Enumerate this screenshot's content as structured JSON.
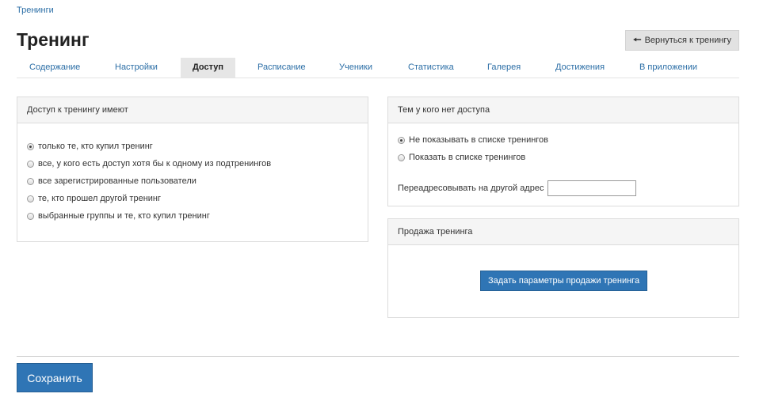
{
  "breadcrumb": {
    "label": "Тренинги"
  },
  "page": {
    "title": "Тренинг"
  },
  "back_button": {
    "icon": "arrow-left-icon",
    "label": "Вернуться к тренингу"
  },
  "tabs": [
    {
      "label": "Содержание",
      "active": false
    },
    {
      "label": "Настройки",
      "active": false
    },
    {
      "label": "Доступ",
      "active": true
    },
    {
      "label": "Расписание",
      "active": false
    },
    {
      "label": "Ученики",
      "active": false
    },
    {
      "label": "Статистика",
      "active": false
    },
    {
      "label": "Галерея",
      "active": false
    },
    {
      "label": "Достижения",
      "active": false
    },
    {
      "label": "В приложении",
      "active": false
    }
  ],
  "access_panel": {
    "title": "Доступ к тренингу имеют",
    "options": [
      {
        "label": "только те, кто купил тренинг",
        "checked": true
      },
      {
        "label": "все, у кого есть доступ хотя бы к одному из подтренингов",
        "checked": false
      },
      {
        "label": "все зарегистрированные пользователи",
        "checked": false
      },
      {
        "label": "те, кто прошел другой тренинг",
        "checked": false
      },
      {
        "label": "выбранные группы и те, кто купил тренинг",
        "checked": false
      }
    ]
  },
  "no_access_panel": {
    "title": "Тем у кого нет доступа",
    "options": [
      {
        "label": "Не показывать в списке тренингов",
        "checked": true
      },
      {
        "label": "Показать в списке тренингов",
        "checked": false
      }
    ],
    "redirect_label": "Переадресовывать на другой адрес",
    "redirect_value": ""
  },
  "sale_panel": {
    "title": "Продажа тренинга",
    "button_label": "Задать параметры продажи тренинга"
  },
  "footer": {
    "save_label": "Сохранить"
  },
  "colors": {
    "link": "#2b6ea6",
    "primary": "#2f75b5",
    "tab_active_bg": "#e6e6e6"
  }
}
